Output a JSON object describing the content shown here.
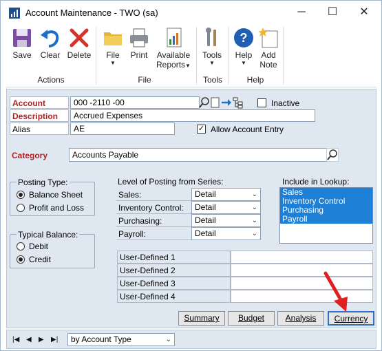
{
  "window": {
    "title": "Account Maintenance  -  TWO (sa)",
    "minimize": "─",
    "maximize": "☐",
    "close": "✕"
  },
  "ribbon": {
    "save": "Save",
    "clear": "Clear",
    "delete": "Delete",
    "group_actions": "Actions",
    "file": "File",
    "print": "Print",
    "available": "Available",
    "reports": "Reports",
    "group_file": "File",
    "tools": "Tools",
    "group_tools": "Tools",
    "help": "Help",
    "add": "Add",
    "note": "Note",
    "group_help": "Help",
    "dropdown_glyph": "▼"
  },
  "form": {
    "account_label": "Account",
    "account_value": "000 -2110 -00",
    "inactive_label": "Inactive",
    "inactive_checked": false,
    "description_label": "Description",
    "description_value": "Accrued Expenses",
    "alias_label": "Alias",
    "alias_value": "AE",
    "allow_entry_label": "Allow Account Entry",
    "allow_entry_checked": true,
    "check_mark": "✓",
    "category_label": "Category",
    "category_value": "Accounts Payable",
    "posting_type_label": "Posting Type:",
    "balance_sheet": "Balance Sheet",
    "profit_loss": "Profit and Loss",
    "typical_balance_label": "Typical Balance:",
    "debit": "Debit",
    "credit": "Credit",
    "level_posting_label": "Level of Posting from Series:",
    "series": [
      {
        "label": "Sales:",
        "value": "Detail"
      },
      {
        "label": "Inventory Control:",
        "value": "Detail"
      },
      {
        "label": "Purchasing:",
        "value": "Detail"
      },
      {
        "label": "Payroll:",
        "value": "Detail"
      }
    ],
    "include_lookup_label": "Include in Lookup:",
    "lookup_items": [
      "Sales",
      "Inventory Control",
      "Purchasing",
      "Payroll"
    ],
    "user_defined": [
      "User-Defined 1",
      "User-Defined 2",
      "User-Defined 3",
      "User-Defined 4"
    ],
    "buttons": {
      "summary": "Summary",
      "budget": "Budget",
      "analysis": "Analysis",
      "currency": "Currency"
    }
  },
  "statusbar": {
    "first": "|◀",
    "prev": "◀",
    "next": "▶",
    "last": "▶|",
    "sort_by": "by Account Type"
  },
  "colors": {
    "required_label": "#b22222",
    "selection": "#1e7fd6",
    "annotation_arrow": "#e02020"
  }
}
